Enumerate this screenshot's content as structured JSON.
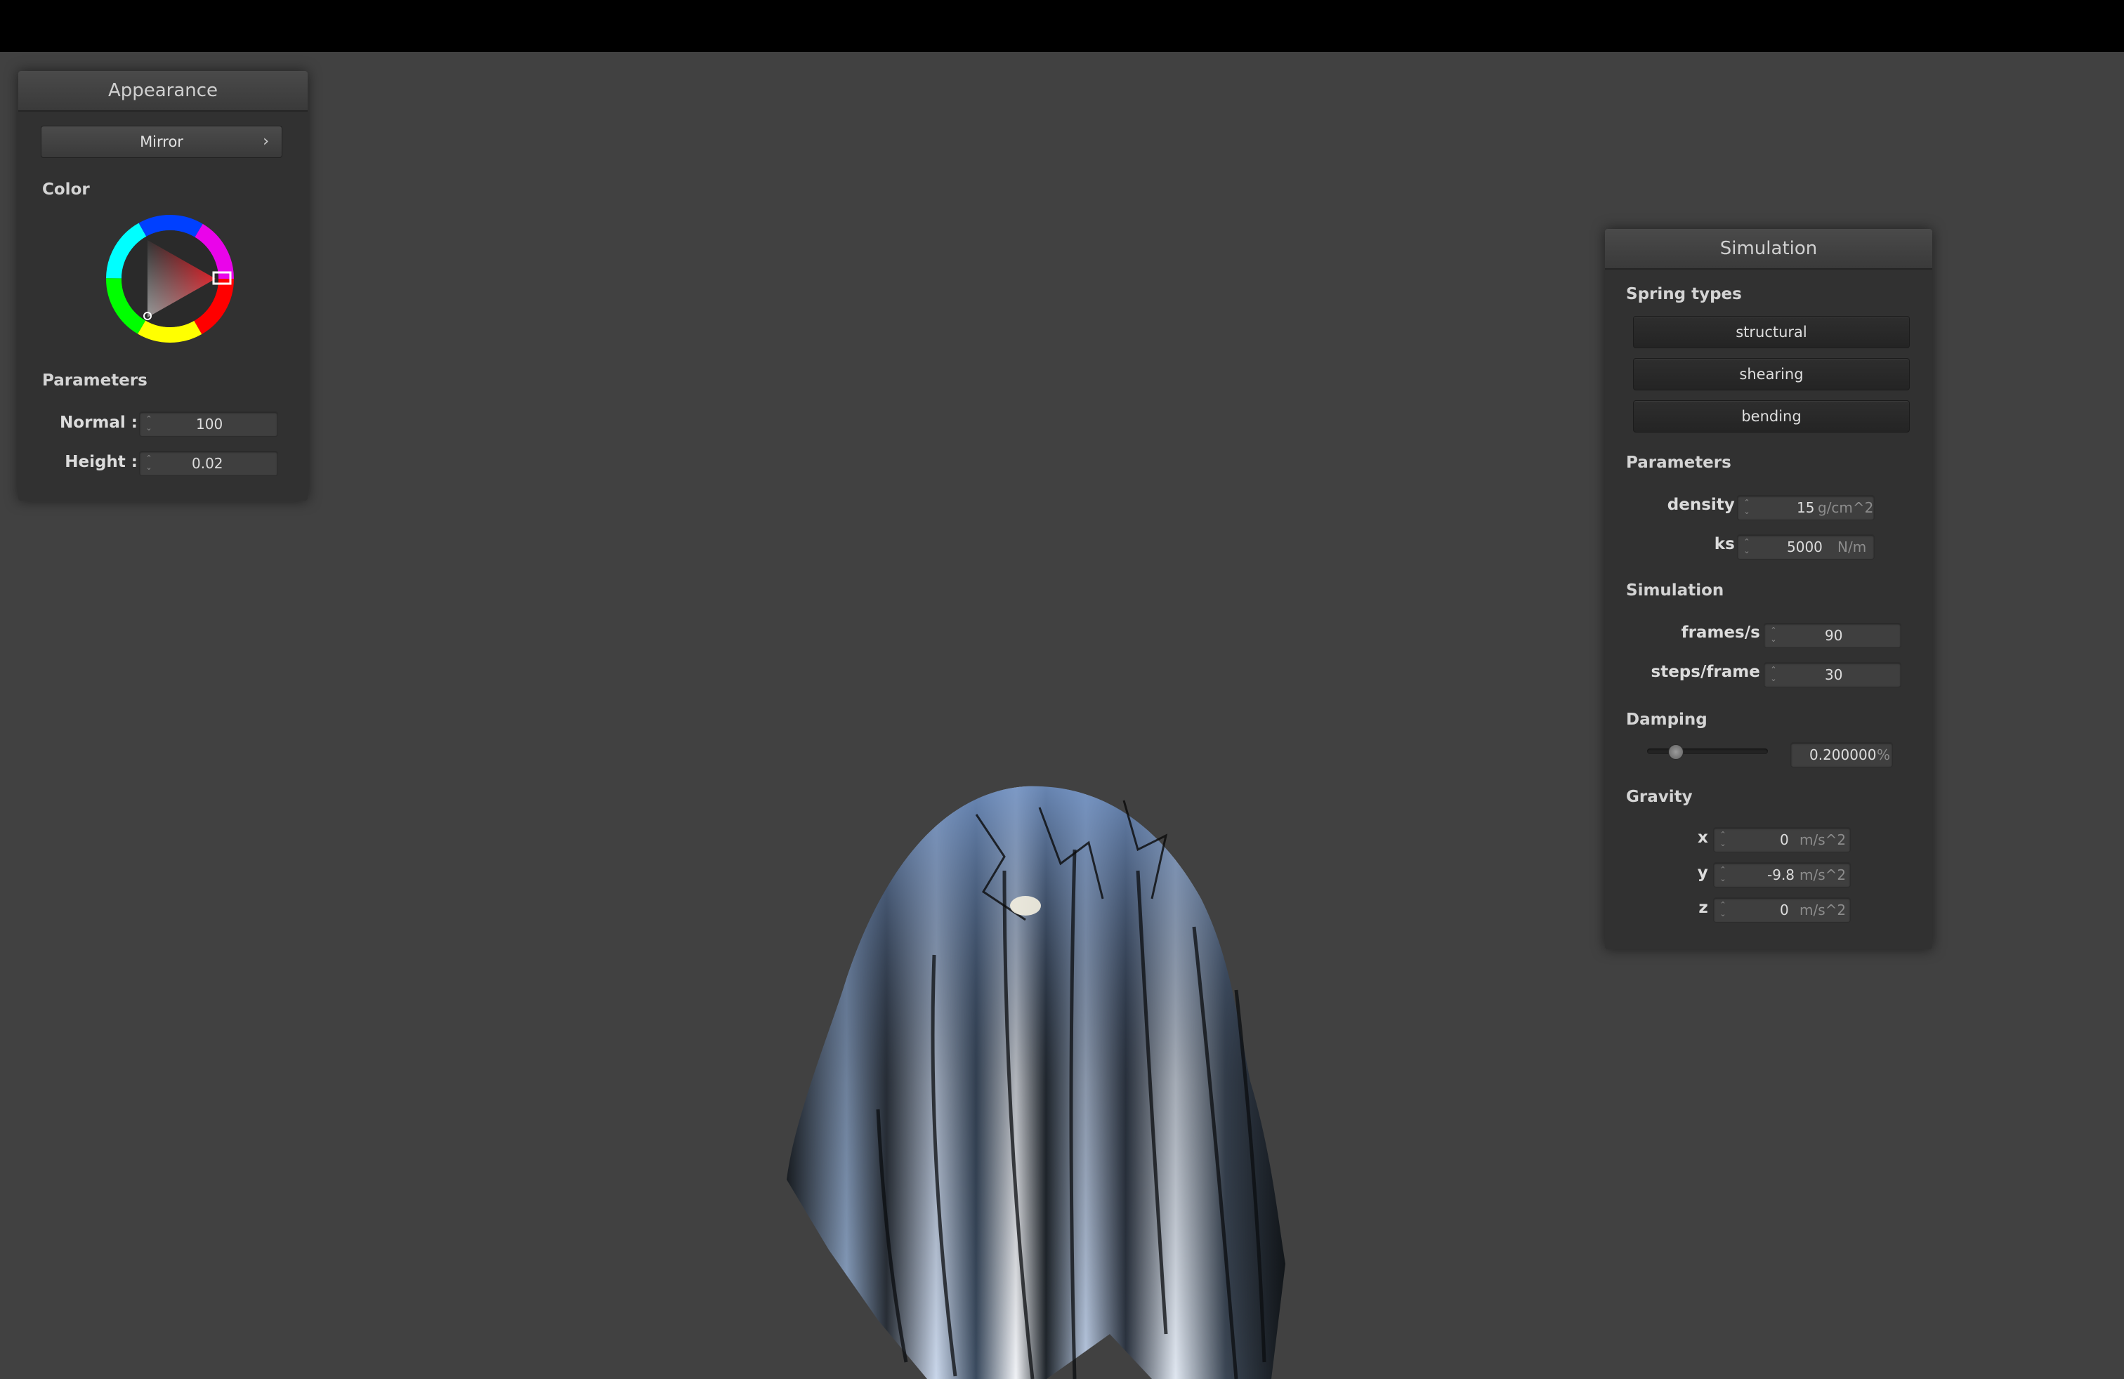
{
  "appearance": {
    "title": "Appearance",
    "material": "Mirror",
    "color_label": "Color",
    "color_value": "#e0262e",
    "parameters_label": "Parameters",
    "normal_label": "Normal :",
    "normal_value": "100",
    "height_label": "Height :",
    "height_value": "0.02"
  },
  "simulation_panel": {
    "title": "Simulation",
    "spring_types_label": "Spring types",
    "spring_buttons": [
      "structural",
      "shearing",
      "bending"
    ],
    "parameters_label": "Parameters",
    "density_label": "density :",
    "density_value": "15",
    "density_unit": "g/cm^2",
    "ks_label": "ks :",
    "ks_value": "5000",
    "ks_unit": "N/m",
    "simulation_label": "Simulation",
    "fps_label": "frames/s :",
    "fps_value": "90",
    "steps_label": "steps/frame :",
    "steps_value": "30",
    "damping_label": "Damping",
    "damping_value": "0.200000",
    "damping_unit": "%",
    "damping_slider_fraction": 0.2,
    "gravity_label": "Gravity",
    "gx_label": "x :",
    "gx_value": "0",
    "gy_label": "y :",
    "gy_value": "-9.8",
    "gz_label": "z :",
    "gz_value": "0",
    "gravity_unit": "m/s^2"
  }
}
